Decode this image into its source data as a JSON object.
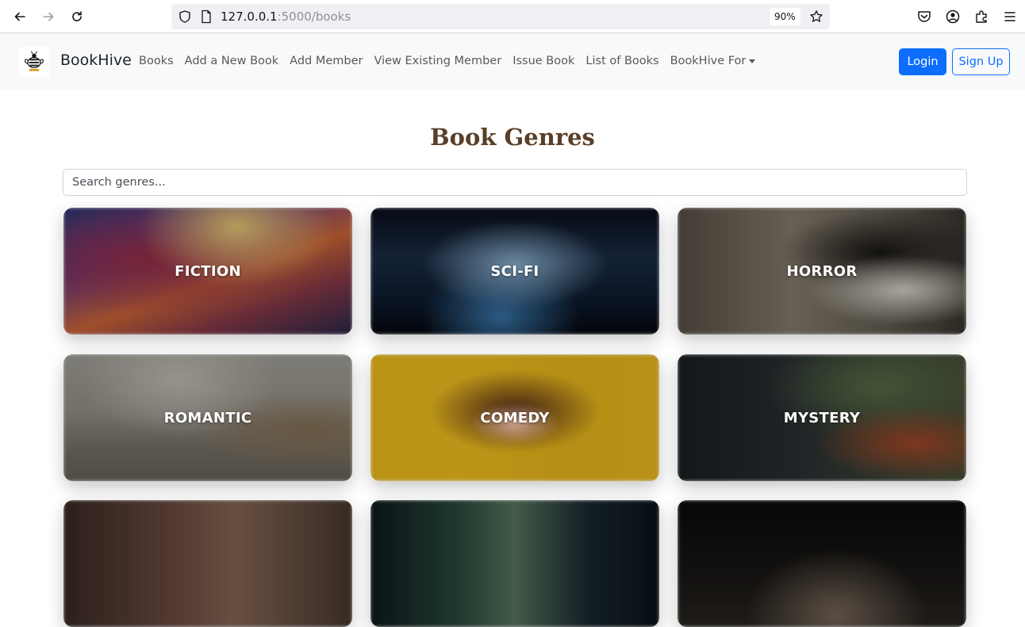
{
  "browser": {
    "url_host": "127.0.0.1",
    "url_path": ":5000/books",
    "zoom": "90%"
  },
  "navbar": {
    "brand": "BookHive",
    "links": [
      "Books",
      "Add a New Book",
      "Add Member",
      "View Existing Member",
      "Issue Book",
      "List of Books",
      "BookHive For"
    ],
    "login_label": "Login",
    "signup_label": "Sign Up"
  },
  "page": {
    "title": "Book Genres",
    "search_placeholder": "Search genres..."
  },
  "genres": [
    "FICTION",
    "SCI-FI",
    "HORROR",
    "ROMANTIC",
    "COMEDY",
    "MYSTERY"
  ],
  "colors": {
    "primary": "#0d6efd",
    "title": "#5a3f28",
    "navbar_bg": "#f8f9fa"
  }
}
